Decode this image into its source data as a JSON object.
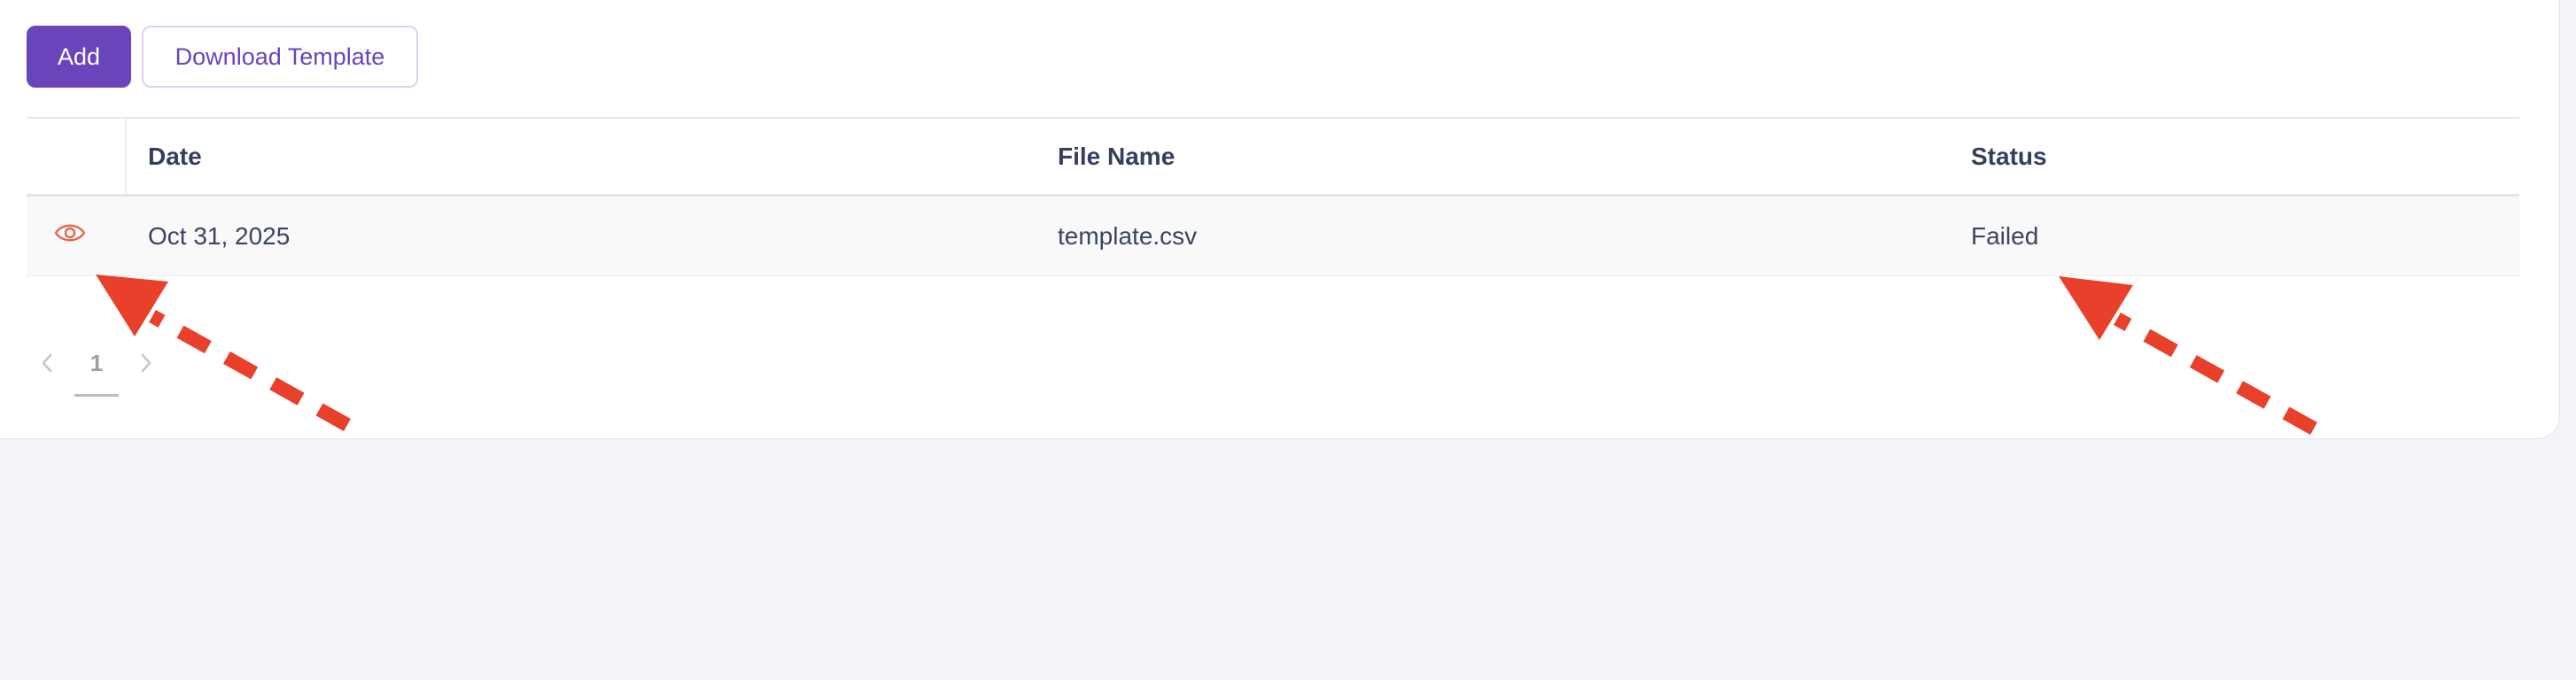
{
  "toolbar": {
    "add_label": "Add",
    "download_template_label": "Download Template"
  },
  "table": {
    "columns": [
      "Date",
      "File Name",
      "Status"
    ],
    "rows": [
      {
        "date": "Oct 31, 2025",
        "file_name": "template.csv",
        "status": "Failed"
      }
    ]
  },
  "pagination": {
    "current_page": "1"
  },
  "icons": {
    "view": "eye-icon",
    "prev": "chevron-left-icon",
    "next": "chevron-right-icon"
  },
  "colors": {
    "accent": "#6a44bb",
    "eye_icon": "#e2674f",
    "annotation_arrow": "#e8402a",
    "page_background": "#f3f3f8"
  }
}
